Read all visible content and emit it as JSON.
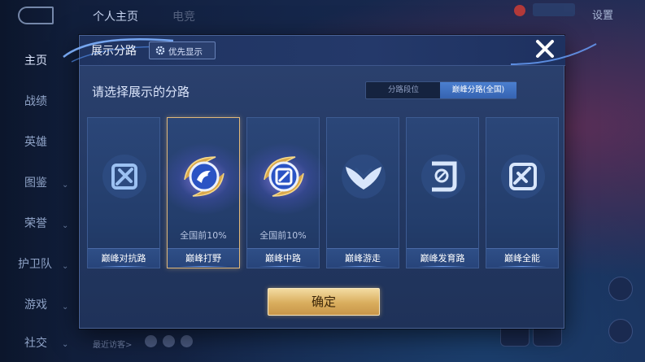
{
  "background": {
    "top_tabs": [
      "个人主页",
      "电竞"
    ],
    "settings_label": "设置",
    "sidebar": [
      "主页",
      "战绩",
      "英雄",
      "图鉴",
      "荣誉",
      "护卫队",
      "游戏",
      "社交"
    ],
    "recent_visitors_label": "最近访客>"
  },
  "dialog": {
    "title": "展示分路",
    "priority_label": "优先显示",
    "subtitle": "请选择展示的分路",
    "toggle": {
      "options": [
        "分路段位",
        "巅峰分路(全国)"
      ],
      "selected": "巅峰分路(全国)"
    },
    "cards": [
      {
        "label": "巅峰对抗路",
        "rank": "",
        "selected": false,
        "icon": "lane-clash-icon"
      },
      {
        "label": "巅峰打野",
        "rank": "全国前10%",
        "selected": true,
        "icon": "jungle-dragon-icon"
      },
      {
        "label": "巅峰中路",
        "rank": "全国前10%",
        "selected": false,
        "icon": "mid-lane-icon"
      },
      {
        "label": "巅峰游走",
        "rank": "",
        "selected": false,
        "icon": "roam-wings-icon"
      },
      {
        "label": "巅峰发育路",
        "rank": "",
        "selected": false,
        "icon": "farm-lane-icon"
      },
      {
        "label": "巅峰全能",
        "rank": "",
        "selected": false,
        "icon": "all-round-icon"
      }
    ],
    "confirm_label": "确定"
  },
  "colors": {
    "accent_gold": "#d9ad5d",
    "selected_border": "#e0b87a",
    "toggle_active": "#3f72c2",
    "dialog_bg": "#233862"
  }
}
